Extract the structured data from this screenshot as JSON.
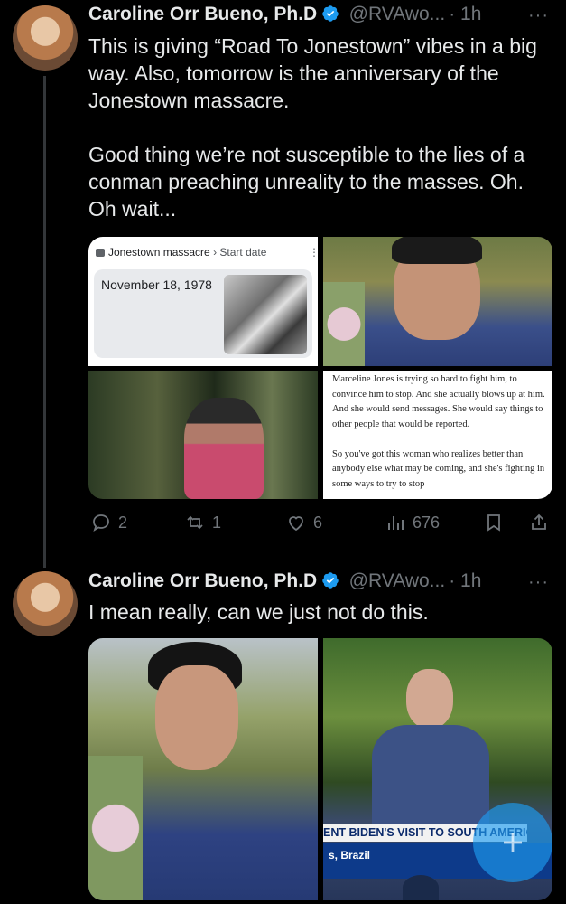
{
  "tweet1": {
    "author_name": "Caroline Orr Bueno, Ph.D",
    "handle": "@RVAwo...",
    "time": "· 1h",
    "more": "···",
    "text": "This is giving “Road To Jonestown” vibes in a big way. Also, tomorrow is the anniversary of the Jonestown massacre.\n\nGood thing we’re not susceptible to the lies of a conman preaching unreality to the masses. Oh. Oh wait...",
    "card": {
      "title": "Jonestown massacre",
      "breadcrumb": "› Start date",
      "date": "November 18, 1978"
    },
    "quote_text": "Marceline Jones is trying so hard to fight him, to convince him to stop. And she actually blows up at him. And she would send messages. She would say things to other people that would be reported.\n\nSo you've got this woman who realizes better than anybody else what may be coming, and she's fighting in some ways to try to stop",
    "actions": {
      "replies": "2",
      "reposts": "1",
      "likes": "6",
      "views": "676"
    }
  },
  "tweet2": {
    "author_name": "Caroline Orr Bueno, Ph.D",
    "handle": "@RVAwo...",
    "time": "· 1h",
    "more": "···",
    "text": "I mean really, can we just not do this.",
    "chyron_main": "ENT BIDEN'S VISIT TO SOUTH AMERICA",
    "chyron_sub": "s, Brazil"
  },
  "colors": {
    "background": "#000000",
    "verified": "#1d9bf0",
    "muted": "#71767b",
    "fab": "#1d9bf0"
  }
}
